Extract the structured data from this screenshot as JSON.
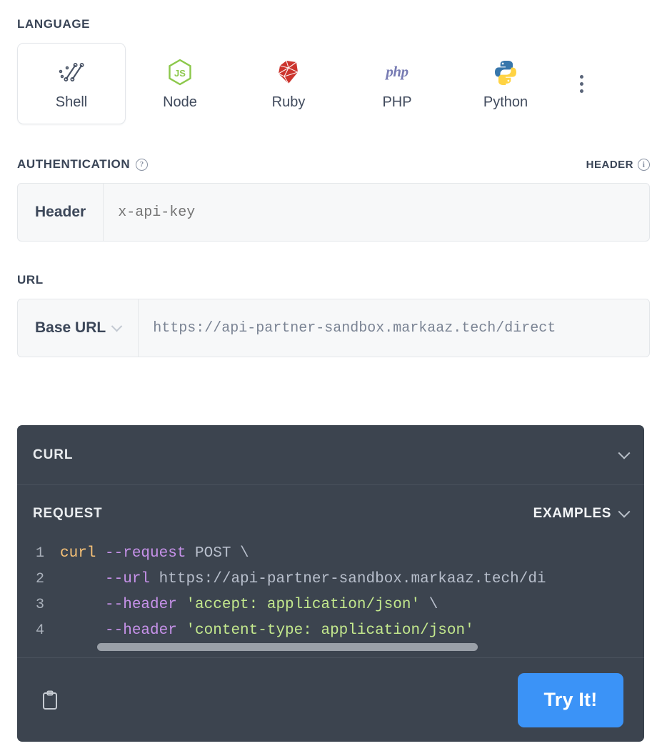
{
  "language": {
    "heading": "LANGUAGE",
    "tabs": [
      {
        "label": "Shell",
        "icon": "shell-icon",
        "selected": true
      },
      {
        "label": "Node",
        "icon": "nodejs-icon",
        "selected": false
      },
      {
        "label": "Ruby",
        "icon": "ruby-icon",
        "selected": false
      },
      {
        "label": "PHP",
        "icon": "php-icon",
        "selected": false
      },
      {
        "label": "Python",
        "icon": "python-icon",
        "selected": false
      }
    ],
    "more_menu_icon": "kebab-menu-icon"
  },
  "authentication": {
    "heading": "AUTHENTICATION",
    "help_icon": "question-mark-icon",
    "right_label": "HEADER",
    "right_info_icon": "info-icon",
    "field": {
      "prefix_label": "Header",
      "value": "",
      "placeholder": "x-api-key"
    }
  },
  "url": {
    "heading": "URL",
    "field": {
      "prefix_label": "Base URL",
      "prefix_chevron_icon": "chevron-down-icon",
      "value": "https://api-partner-sandbox.markaaz.tech/direct"
    }
  },
  "code_panel": {
    "title": "CURL",
    "title_chevron_icon": "chevron-down-icon",
    "request_label": "REQUEST",
    "examples_label": "EXAMPLES",
    "examples_chevron_icon": "chevron-down-icon",
    "lines": [
      {
        "number": "1",
        "tokens": [
          {
            "text": "curl ",
            "type": "cmd"
          },
          {
            "text": "--request ",
            "type": "flag"
          },
          {
            "text": "POST \\",
            "type": "plain"
          }
        ]
      },
      {
        "number": "2",
        "tokens": [
          {
            "text": "     ",
            "type": "plain"
          },
          {
            "text": "--url ",
            "type": "flag"
          },
          {
            "text": "https://api-partner-sandbox.markaaz.tech/di",
            "type": "plain"
          }
        ]
      },
      {
        "number": "3",
        "tokens": [
          {
            "text": "     ",
            "type": "plain"
          },
          {
            "text": "--header ",
            "type": "flag"
          },
          {
            "text": "'accept: application/json'",
            "type": "str"
          },
          {
            "text": " \\",
            "type": "plain"
          }
        ]
      },
      {
        "number": "4",
        "tokens": [
          {
            "text": "     ",
            "type": "plain"
          },
          {
            "text": "--header ",
            "type": "flag"
          },
          {
            "text": "'content-type: application/json'",
            "type": "str"
          }
        ]
      }
    ],
    "copy_icon": "clipboard-copy-icon",
    "try_button_label": "Try It!"
  },
  "colors": {
    "accent_blue": "#3b93f7",
    "panel_dark": "#3c444f",
    "field_bg": "#f7f8f9",
    "token_cmd": "#f6c177",
    "token_flag": "#c792ea",
    "token_string": "#c3e88d",
    "token_plain": "#b8bfcc",
    "node_green": "#8cc84b",
    "ruby_red": "#cc342d",
    "php_purple": "#777bb3",
    "python_blue": "#3776ab",
    "python_yellow": "#ffd343"
  }
}
